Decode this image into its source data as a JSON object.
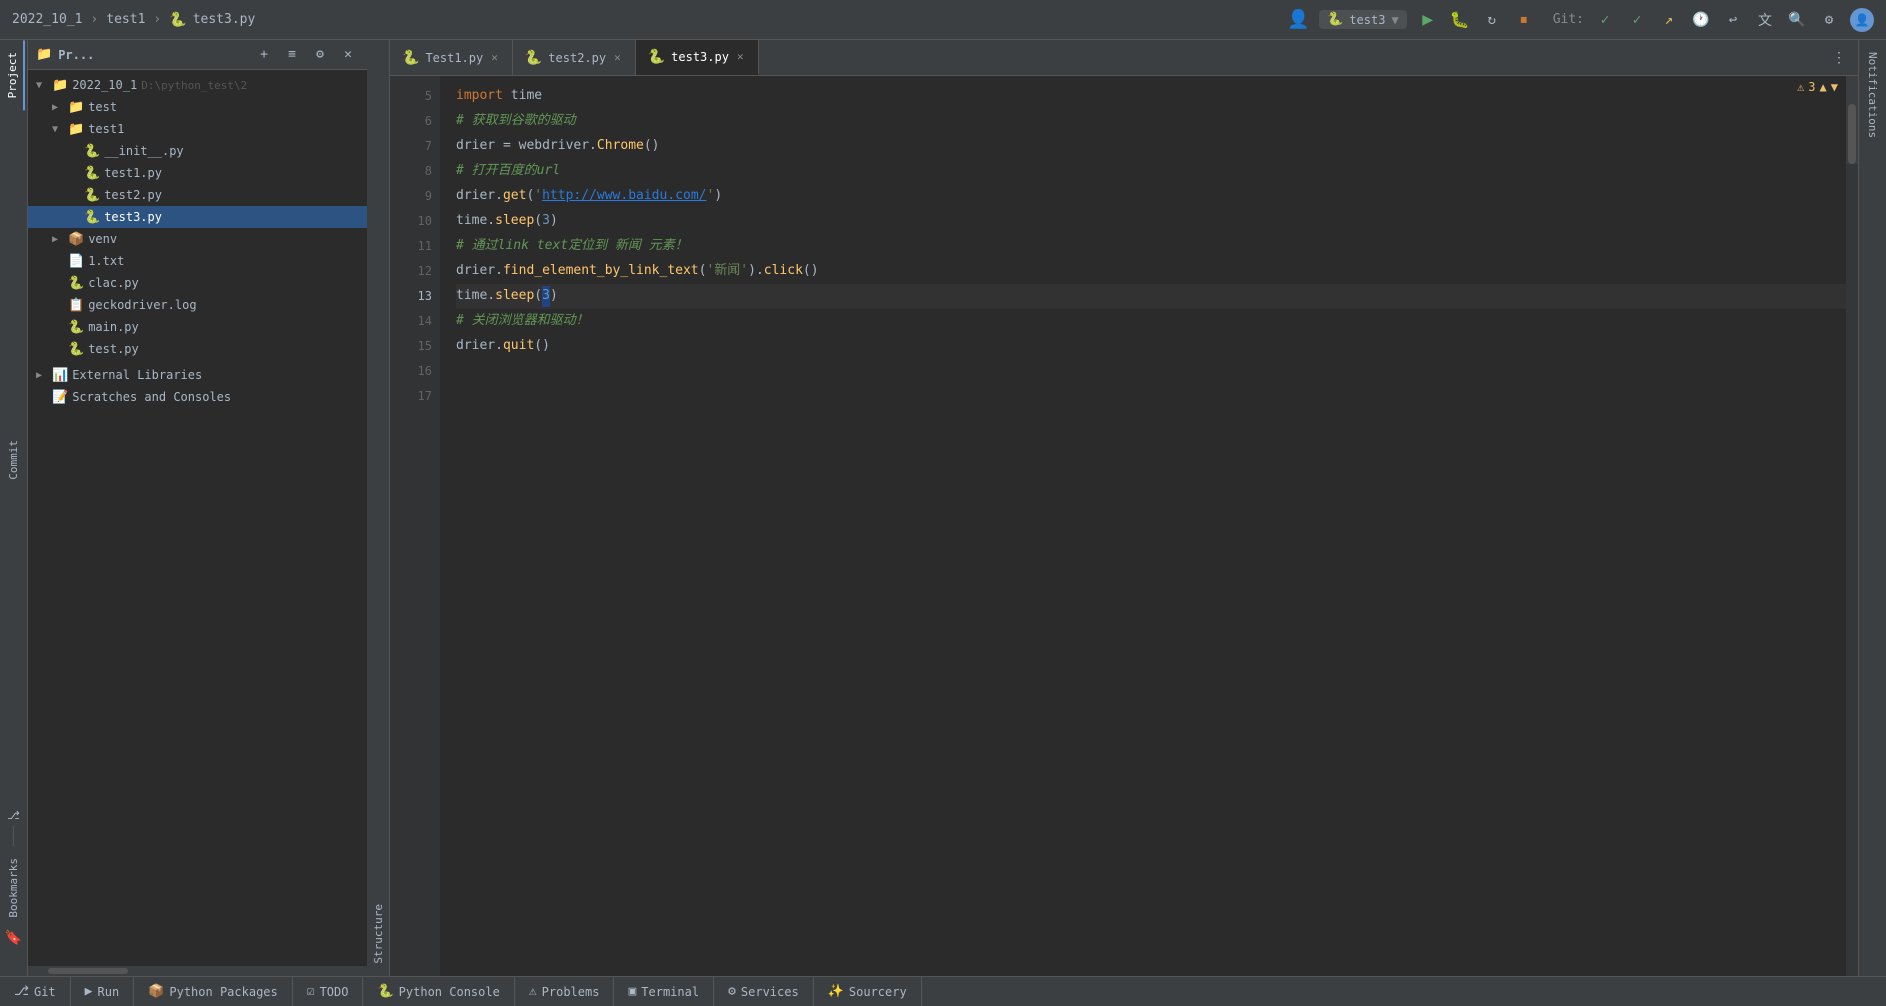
{
  "titlebar": {
    "breadcrumb": [
      "2022_10_1",
      "test1",
      "test3.py"
    ],
    "run_config": "test3",
    "git_label": "Git:",
    "buttons": {
      "run": "▶",
      "debug": "🐞",
      "stop": "⏹",
      "more": "⋮"
    }
  },
  "tabs": [
    {
      "id": "test1py",
      "label": "Test1.py",
      "icon": "🐍",
      "active": false,
      "closable": true
    },
    {
      "id": "test2py",
      "label": "test2.py",
      "icon": "🐍",
      "active": false,
      "closable": true
    },
    {
      "id": "test3py",
      "label": "test3.py",
      "icon": "🐍",
      "active": true,
      "closable": true
    }
  ],
  "project": {
    "title": "Pr...",
    "root": {
      "label": "2022_10_1",
      "path": "D:\\python_test\\2",
      "children": [
        {
          "label": "test",
          "type": "folder",
          "expanded": false
        },
        {
          "label": "test1",
          "type": "folder",
          "expanded": true,
          "children": [
            {
              "label": "__init__.py",
              "type": "py"
            },
            {
              "label": "test1.py",
              "type": "py"
            },
            {
              "label": "test2.py",
              "type": "py"
            },
            {
              "label": "test3.py",
              "type": "py",
              "selected": true
            }
          ]
        },
        {
          "label": "venv",
          "type": "folder-venv",
          "expanded": false
        },
        {
          "label": "1.txt",
          "type": "txt"
        },
        {
          "label": "clac.py",
          "type": "py"
        },
        {
          "label": "geckodriver.log",
          "type": "log"
        },
        {
          "label": "main.py",
          "type": "py"
        },
        {
          "label": "test.py",
          "type": "py"
        }
      ]
    },
    "external_libraries": "External Libraries",
    "scratches": "Scratches and Consoles"
  },
  "code": {
    "lines": [
      {
        "num": 5,
        "content": "import time"
      },
      {
        "num": 6,
        "content": "# 获取到谷歌的驱动"
      },
      {
        "num": 7,
        "content": "drier = webdriver.Chrome()"
      },
      {
        "num": 8,
        "content": "# 打开百度的url"
      },
      {
        "num": 9,
        "content": "drier.get('http://www.baidu.com/')"
      },
      {
        "num": 10,
        "content": "time.sleep(3)"
      },
      {
        "num": 11,
        "content": "# 通过link text定位到 新闻 元素！"
      },
      {
        "num": 12,
        "content": "drier.find_element_by_link_text('新闻').click()"
      },
      {
        "num": 13,
        "content": "time.sleep(3)",
        "cursor": true
      },
      {
        "num": 14,
        "content": "# 关闭浏览器和驱动！"
      },
      {
        "num": 15,
        "content": "drier.quit()"
      },
      {
        "num": 16,
        "content": ""
      },
      {
        "num": 17,
        "content": ""
      }
    ]
  },
  "warnings": {
    "count": 3,
    "icon": "⚠"
  },
  "bottom_tabs": [
    {
      "id": "git",
      "label": "Git",
      "icon": "⎇",
      "active": false
    },
    {
      "id": "run",
      "label": "Run",
      "icon": "▶",
      "active": false
    },
    {
      "id": "python_packages",
      "label": "Python Packages",
      "icon": "📦",
      "active": false
    },
    {
      "id": "todo",
      "label": "TODO",
      "icon": "☑",
      "active": false
    },
    {
      "id": "python_console",
      "label": "Python Console",
      "icon": "🐍",
      "active": false
    },
    {
      "id": "problems",
      "label": "Problems",
      "icon": "⚠",
      "active": false
    },
    {
      "id": "terminal",
      "label": "Terminal",
      "icon": "▣",
      "active": false
    },
    {
      "id": "services",
      "label": "Services",
      "icon": "⚙",
      "active": false
    },
    {
      "id": "sourcery",
      "label": "Sourcery",
      "icon": "✨",
      "active": false
    }
  ],
  "side_labels": {
    "project": "Project",
    "commit": "Commit",
    "bookmarks": "Bookmarks",
    "structure": "Structure",
    "notifications": "Notifications"
  }
}
